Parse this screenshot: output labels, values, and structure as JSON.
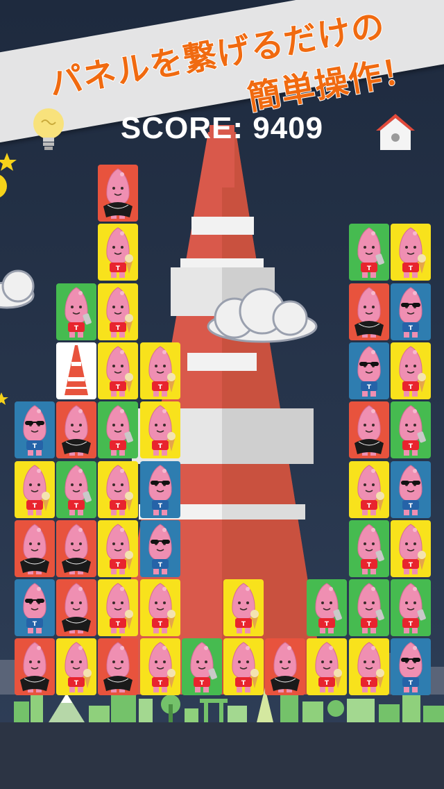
{
  "banner": {
    "line1": "パネルを繋げるだけの",
    "line2": "簡単操作！"
  },
  "score": {
    "text": "SCORE: 9409"
  },
  "icons": {
    "hint": "lightbulb-icon",
    "home": "home-icon"
  },
  "colors": {
    "background": "#2b3a52",
    "panel_red": "#e8533d",
    "panel_yellow": "#f8e21c",
    "panel_green": "#46bb50",
    "panel_blue": "#2e7db0",
    "panel_white": "#ffffff",
    "banner_text": "#f06a10",
    "tower_red": "#d9594b"
  },
  "characters": {
    "R": "character-with-black-cape",
    "Y": "character-holding-soft-serve",
    "G": "character-holding-smartphone",
    "B": "character-with-sunglasses",
    "W": "tokyo-tower-tile"
  },
  "board": {
    "columns": 10,
    "grid": [
      [
        "",
        "",
        "R",
        "",
        "",
        "",
        "",
        "",
        "",
        ""
      ],
      [
        "",
        "",
        "Y",
        "",
        "",
        "",
        "",
        "",
        "G",
        "Y"
      ],
      [
        "",
        "G",
        "Y",
        "",
        "",
        "",
        "",
        "",
        "R",
        "B"
      ],
      [
        "",
        "W",
        "Y",
        "Y",
        "",
        "",
        "",
        "",
        "B",
        "Y"
      ],
      [
        "B",
        "R",
        "G",
        "Y",
        "",
        "",
        "",
        "",
        "R",
        "G"
      ],
      [
        "Y",
        "G",
        "Y",
        "B",
        "",
        "",
        "",
        "",
        "Y",
        "B"
      ],
      [
        "R",
        "R",
        "Y",
        "B",
        "",
        "",
        "",
        "",
        "G",
        "Y"
      ],
      [
        "B",
        "R",
        "Y",
        "Y",
        "",
        "Y",
        "",
        "G",
        "G",
        "G"
      ],
      [
        "R",
        "Y",
        "R",
        "Y",
        "G",
        "Y",
        "R",
        "Y",
        "Y",
        "B"
      ]
    ]
  }
}
